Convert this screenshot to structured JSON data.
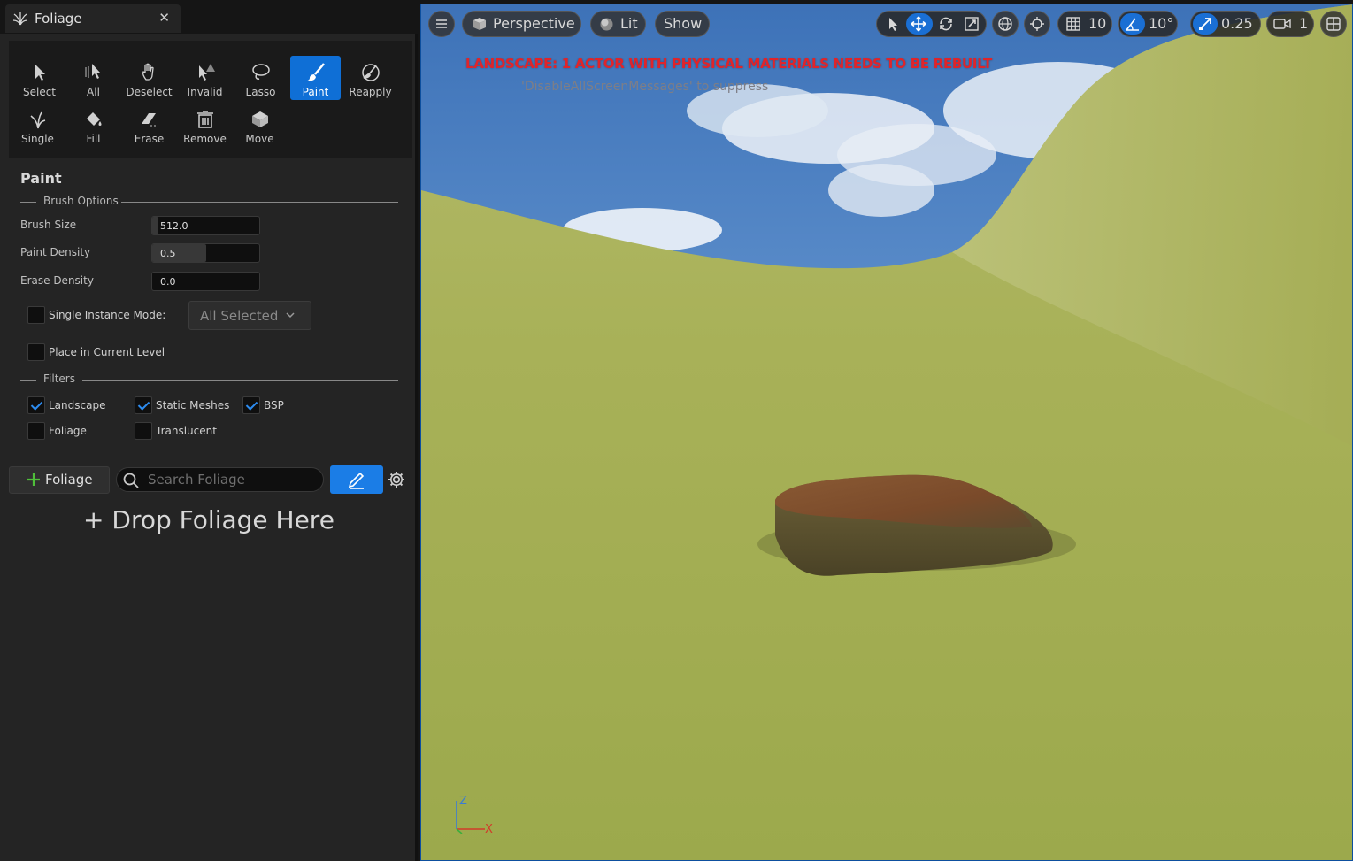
{
  "panel": {
    "tab_title": "Foliage",
    "tab_close": "✕",
    "tools": [
      {
        "label": "Select",
        "icon": "cursor-icon",
        "active": false
      },
      {
        "label": "All",
        "icon": "select-all-icon",
        "active": false
      },
      {
        "label": "Deselect",
        "icon": "hand-icon",
        "active": false
      },
      {
        "label": "Invalid",
        "icon": "invalid-icon",
        "active": false
      },
      {
        "label": "Lasso",
        "icon": "lasso-icon",
        "active": false
      },
      {
        "label": "Paint",
        "icon": "paint-brush-icon",
        "active": true
      },
      {
        "label": "Reapply",
        "icon": "reapply-icon",
        "active": false
      },
      {
        "label": "Single",
        "icon": "grass-icon",
        "active": false
      },
      {
        "label": "Fill",
        "icon": "fill-bucket-icon",
        "active": false
      },
      {
        "label": "Erase",
        "icon": "eraser-icon",
        "active": false
      },
      {
        "label": "Remove",
        "icon": "trash-icon",
        "active": false
      },
      {
        "label": "Move",
        "icon": "move-box-icon",
        "active": false
      }
    ],
    "paint_heading": "Paint",
    "brush_options_header": "Brush Options",
    "brush_size": {
      "label": "Brush Size",
      "value": "512.0",
      "fill": 0.06
    },
    "paint_density": {
      "label": "Paint Density",
      "value": "0.5",
      "fill": 0.5
    },
    "erase_density": {
      "label": "Erase Density",
      "value": "0.0",
      "fill": 0.0
    },
    "single_instance": {
      "label": "Single Instance Mode:",
      "checked": false,
      "dropdown_value": "All Selected"
    },
    "place_in_level": {
      "label": "Place in Current Level",
      "checked": false
    },
    "filters_header": "Filters",
    "filters": [
      {
        "label": "Landscape",
        "checked": true
      },
      {
        "label": "Static Meshes",
        "checked": true
      },
      {
        "label": "BSP",
        "checked": true
      },
      {
        "label": "Foliage",
        "checked": false
      },
      {
        "label": "Translucent",
        "checked": false
      }
    ],
    "add_foliage_label": "Foliage",
    "search_placeholder": "Search Foliage",
    "drop_hint": "+ Drop Foliage Here"
  },
  "viewport": {
    "perspective_label": "Perspective",
    "lit_label": "Lit",
    "show_label": "Show",
    "grid_snap": "10",
    "rotation_snap": "10°",
    "scale_snap": "0.25",
    "camera_speed": "1",
    "rebuild_message": "LANDSCAPE: 1 ACTOR WITH PHYSICAL MATERIALS NEEDS TO BE REBUILT",
    "suppress_message": "'DisableAllScreenMessages' to suppress",
    "axis_z": "Z",
    "axis_x": "X",
    "colors": {
      "accent": "#1a6fd4",
      "warning": "#e0242a",
      "grass": "#a7b154",
      "sky": "#4f86c8"
    }
  }
}
